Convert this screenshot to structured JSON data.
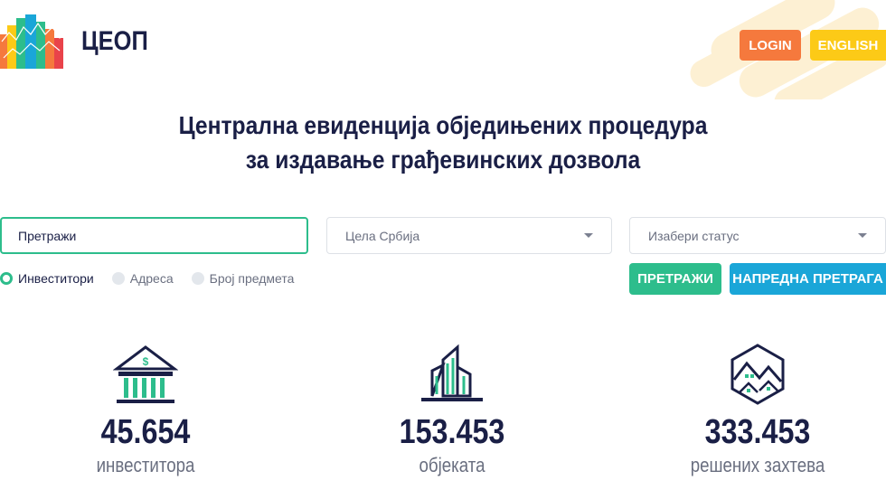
{
  "header": {
    "logo_text": "ЦЕОП",
    "login_label": "LOGIN",
    "english_label": "ENGLISH"
  },
  "headline": {
    "line1": "Централна евиденција обједињених процедура",
    "line2": "за издавање грађевинских дозвола"
  },
  "search": {
    "value": "Претражи",
    "region_selected": "Цела Србија",
    "status_placeholder": "Изабери статус",
    "radios": [
      {
        "label": "Инвеститори",
        "checked": true
      },
      {
        "label": "Адреса",
        "checked": false
      },
      {
        "label": "Број предмета",
        "checked": false
      }
    ],
    "search_button": "ПРЕТРАЖИ",
    "advanced_button": "НАПРЕДНА ПРЕТРАГА"
  },
  "stats": [
    {
      "value": "45.654",
      "label": "инвеститора",
      "icon": "bank-icon"
    },
    {
      "value": "153.453",
      "label": "објеката",
      "icon": "building-icon"
    },
    {
      "value": "333.453",
      "label": "решених захтева",
      "icon": "houses-hexagon-icon"
    }
  ],
  "colors": {
    "primary_dark": "#1a1f46",
    "green": "#2dbd8c",
    "blue": "#1aa6d8",
    "orange": "#f5793d",
    "yellow": "#fcca17"
  }
}
